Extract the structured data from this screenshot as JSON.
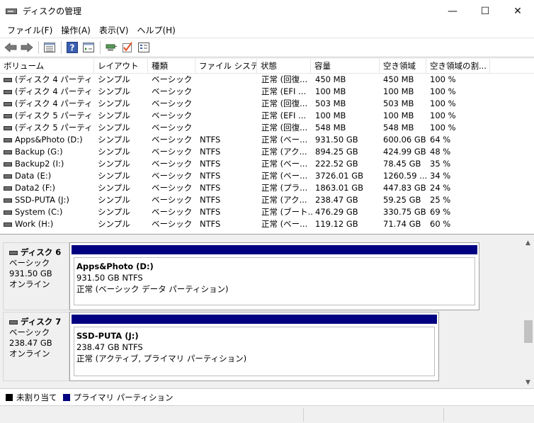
{
  "window": {
    "title": "ディスクの管理",
    "minimize": "—",
    "maximize": "☐",
    "close": "✕"
  },
  "menu": [
    "ファイル(F)",
    "操作(A)",
    "表示(V)",
    "ヘルプ(H)"
  ],
  "toolbar": [
    "back-arrow-icon",
    "forward-arrow-icon",
    "disk-list-icon",
    "help-icon",
    "properties-icon",
    "connect-icon",
    "check-icon",
    "settings-icon"
  ],
  "columns": [
    "ボリューム",
    "レイアウト",
    "種類",
    "ファイル システム",
    "状態",
    "容量",
    "空き領域",
    "空き領域の割..."
  ],
  "volumes": [
    [
      "(ディスク 4 パーティシ...",
      "シンプル",
      "ベーシック",
      "",
      "正常 (回復...",
      "450 MB",
      "450 MB",
      "100 %"
    ],
    [
      "(ディスク 4 パーティシ...",
      "シンプル",
      "ベーシック",
      "",
      "正常 (EFI ...",
      "100 MB",
      "100 MB",
      "100 %"
    ],
    [
      "(ディスク 4 パーティシ...",
      "シンプル",
      "ベーシック",
      "",
      "正常 (回復...",
      "503 MB",
      "503 MB",
      "100 %"
    ],
    [
      "(ディスク 5 パーティシ...",
      "シンプル",
      "ベーシック",
      "",
      "正常 (EFI ...",
      "100 MB",
      "100 MB",
      "100 %"
    ],
    [
      "(ディスク 5 パーティシ...",
      "シンプル",
      "ベーシック",
      "",
      "正常 (回復...",
      "548 MB",
      "548 MB",
      "100 %"
    ],
    [
      "Apps&Photo (D:)",
      "シンプル",
      "ベーシック",
      "NTFS",
      "正常 (ベー...",
      "931.50 GB",
      "600.06 GB",
      "64 %"
    ],
    [
      "Backup (G:)",
      "シンプル",
      "ベーシック",
      "NTFS",
      "正常 (アク...",
      "894.25 GB",
      "424.99 GB",
      "48 %"
    ],
    [
      "Backup2 (I:)",
      "シンプル",
      "ベーシック",
      "NTFS",
      "正常 (ベー...",
      "222.52 GB",
      "78.45 GB",
      "35 %"
    ],
    [
      "Data (E:)",
      "シンプル",
      "ベーシック",
      "NTFS",
      "正常 (ベー...",
      "3726.01 GB",
      "1260.59 ...",
      "34 %"
    ],
    [
      "Data2 (F:)",
      "シンプル",
      "ベーシック",
      "NTFS",
      "正常 (プラ...",
      "1863.01 GB",
      "447.83 GB",
      "24 %"
    ],
    [
      "SSD-PUTA (J:)",
      "シンプル",
      "ベーシック",
      "NTFS",
      "正常 (アク...",
      "238.47 GB",
      "59.25 GB",
      "25 %"
    ],
    [
      "System (C:)",
      "シンプル",
      "ベーシック",
      "NTFS",
      "正常 (ブート...",
      "476.29 GB",
      "330.75 GB",
      "69 %"
    ],
    [
      "Work (H:)",
      "シンプル",
      "ベーシック",
      "NTFS",
      "正常 (ベー...",
      "119.12 GB",
      "71.74 GB",
      "60 %"
    ]
  ],
  "disks": [
    {
      "name": "ディスク 6",
      "type": "ベーシック",
      "size": "931.50 GB",
      "status": "オンライン",
      "partition": {
        "name": "Apps&Photo  (D:)",
        "size": "931.50 GB NTFS",
        "status": "正常 (ベーシック データ パーティション)"
      }
    },
    {
      "name": "ディスク 7",
      "type": "ベーシック",
      "size": "238.47 GB",
      "status": "オンライン",
      "partition": {
        "name": "SSD-PUTA  (J:)",
        "size": "238.47 GB NTFS",
        "status": "正常 (アクティブ, プライマリ パーティション)"
      }
    }
  ],
  "legend": [
    {
      "label": "未割り当て",
      "color": "#000000"
    },
    {
      "label": "プライマリ パーティション",
      "color": "#000080"
    }
  ],
  "scroll": {
    "up": "▲",
    "down": "▼"
  }
}
